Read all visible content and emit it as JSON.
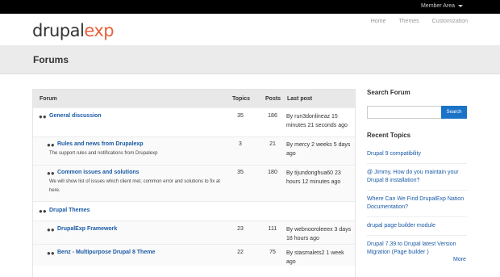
{
  "topbar": {
    "member_area": "Member Area"
  },
  "header": {
    "logo_a": "drupal",
    "logo_b": "exp",
    "nav": [
      "Home",
      "Themes",
      "Customization"
    ]
  },
  "page_title": "Forums",
  "table": {
    "headers": {
      "forum": "Forum",
      "topics": "Topics",
      "posts": "Posts",
      "last": "Last post"
    },
    "rows": [
      {
        "name": "General discussion",
        "desc": "",
        "topics": "35",
        "posts": "186",
        "last": "By run3donlineaz 15 minutes 21 seconds ago"
      },
      {
        "name": "Rules and news from Drupalexp",
        "desc": "The support rules and notifications from Drupalexp",
        "topics": "3",
        "posts": "21",
        "last": "By mercy 2 weeks 5 days ago"
      },
      {
        "name": "Common issues and solutions",
        "desc": "We will show list of issues which client met, common error and solutions to fix at here.",
        "topics": "35",
        "posts": "180",
        "last": "By tijundonghua60 23 hours 12 minutes ago"
      },
      {
        "name": "Drupal Themes",
        "desc": "",
        "topics": "",
        "posts": "",
        "last": ""
      },
      {
        "name": "DrupalExp Framework",
        "desc": "",
        "topics": "23",
        "posts": "111",
        "last": "By webnooroleeex 3 days 18 hours ago"
      },
      {
        "name": "Benz - Multipurpose Drupal 8 Theme",
        "desc": "",
        "topics": "22",
        "posts": "75",
        "last": "By stasmalets2 1 week ago"
      }
    ]
  },
  "sidebar": {
    "search_heading": "Search Forum",
    "search_value": "",
    "search_button": "Search",
    "recent_heading": "Recent Topics",
    "recent": [
      "Drupal 9 compatibility",
      "@ Jimmy, How do you maintain your Drupal 8 installation?",
      "Where Can We Find DrupalExp Nation Documentation?",
      "drupal page builder module",
      "Drupal 7.39 to Drupal latest Version Migration (Page builder )"
    ],
    "more": "More"
  },
  "icons": {
    "forum": "comments-icon"
  }
}
